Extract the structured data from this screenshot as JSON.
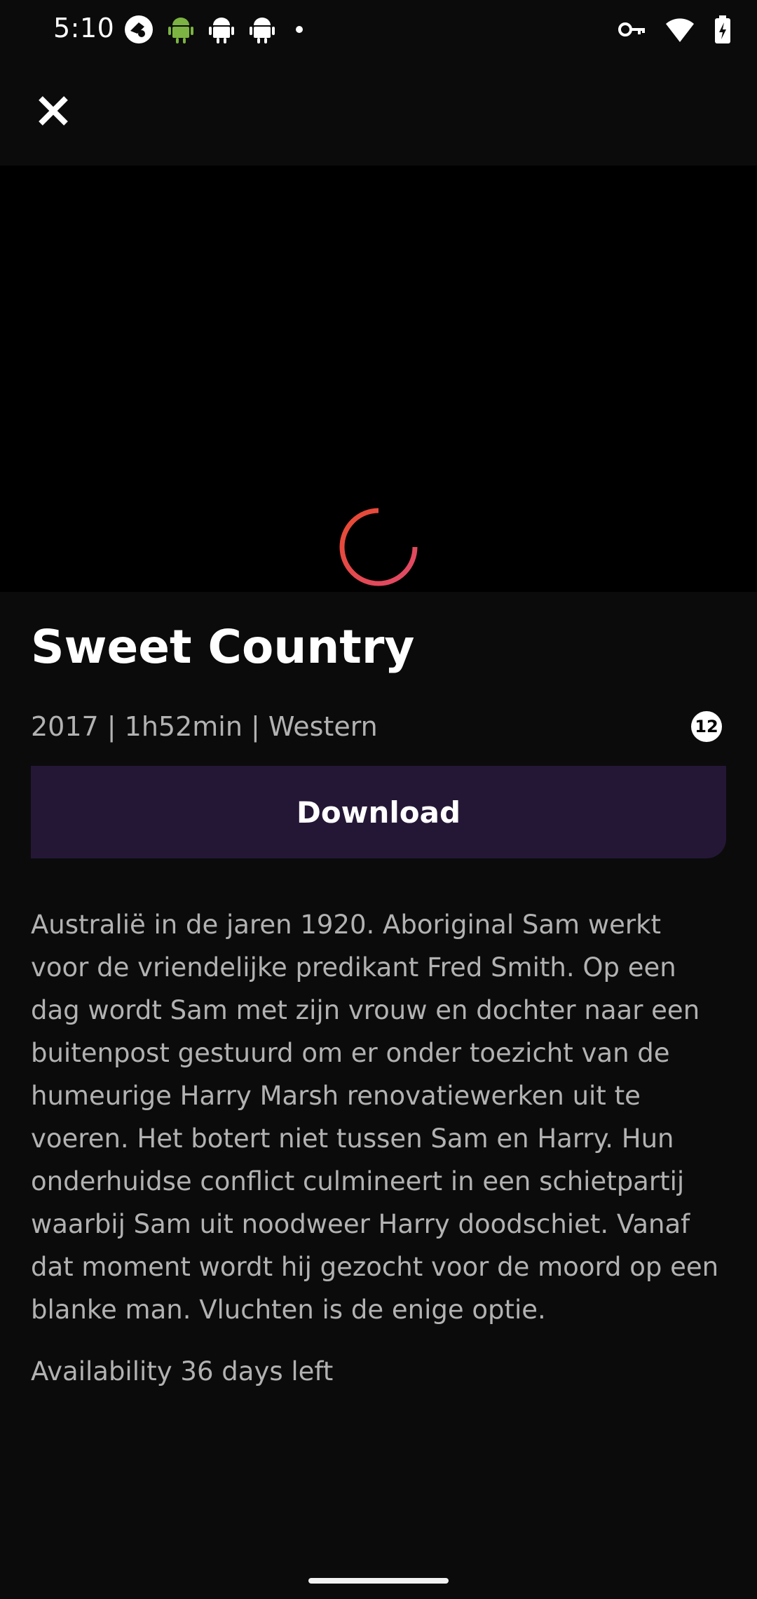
{
  "status_bar": {
    "time": "5:10",
    "icons": [
      "app-icon",
      "android-icon",
      "android-icon",
      "android-icon",
      "dot-icon",
      "vpn-key-icon",
      "wifi-icon",
      "battery-charging-icon"
    ]
  },
  "header": {
    "close_icon": "close-icon"
  },
  "player": {
    "state": "loading",
    "spinner_color": "#e5484d"
  },
  "movie": {
    "title": "Sweet Country",
    "meta": "2017 | 1h52min | Western",
    "age_rating": "12",
    "download_label": "Download",
    "description": "Australië in de jaren 1920. Aboriginal Sam werkt voor de vriendelijke predikant Fred Smith. Op een dag wordt Sam met zijn vrouw en dochter naar een buitenpost gestuurd om er onder toezicht van de humeurige Harry Marsh renovatiewerken uit te voeren. Het botert niet tussen Sam en Harry. Hun onderhuidse conflict culmineert in een schietpartij waarbij Sam uit noodweer Harry doodschiet. Vanaf dat moment wordt hij gezocht voor de moord op een blanke man. Vluchten is de enige optie.",
    "availability": "Availability 36 days left"
  },
  "colors": {
    "background": "#0b0b0b",
    "button": "#241736",
    "secondary_text": "#b2b2b2"
  }
}
